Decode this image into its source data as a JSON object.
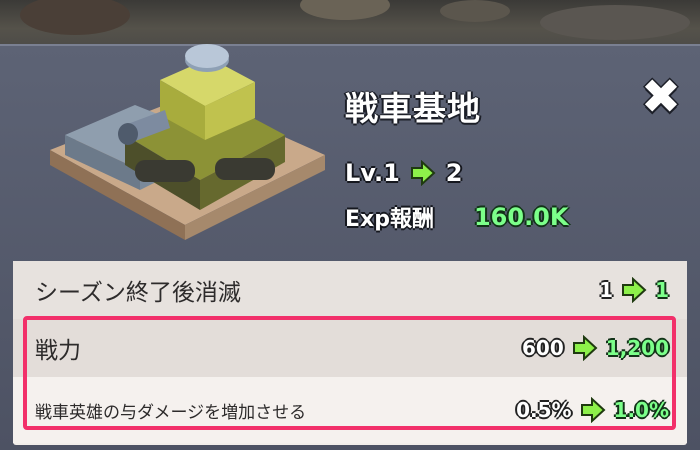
{
  "building": {
    "name": "戦車基地",
    "icon": "tank-base-icon"
  },
  "level": {
    "label": "Lv.1",
    "next": "2"
  },
  "exp": {
    "label": "Exp報酬",
    "value": "160.0K"
  },
  "stats": [
    {
      "label": "シーズン終了後消滅",
      "from": "1",
      "to": "1"
    },
    {
      "label": "戦力",
      "from": "600",
      "to": "1,200"
    },
    {
      "label": "戦車英雄の与ダメージを増加させる",
      "from": "0.5%",
      "to": "1.0%"
    }
  ],
  "colors": {
    "accent_green": "#7cff8a",
    "highlight": "#f2306a",
    "panel": "#5d6375"
  },
  "icons": {
    "close": "close-icon",
    "arrow": "green-arrow-icon"
  }
}
